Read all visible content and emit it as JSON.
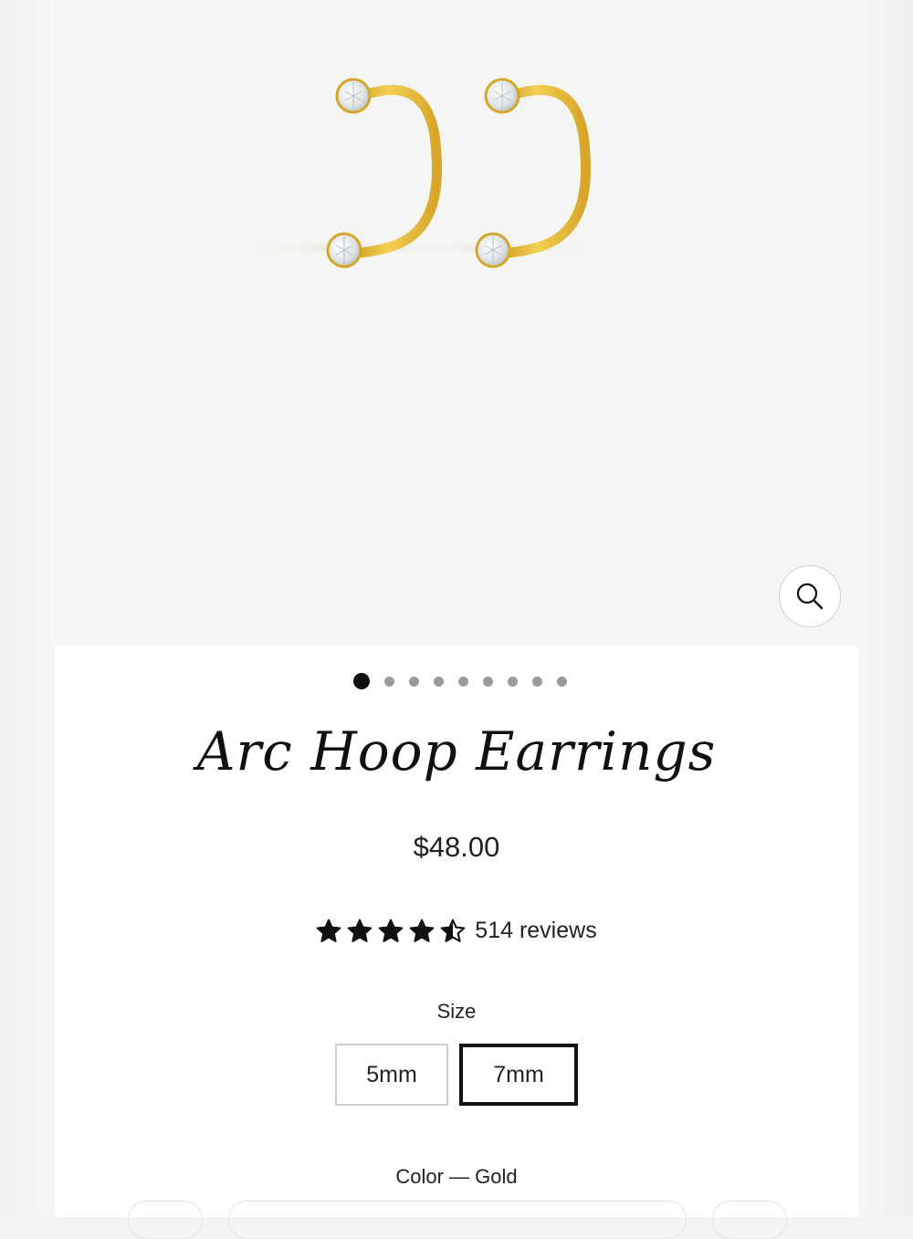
{
  "product": {
    "title": "Arc Hoop Earrings",
    "price": "$48.00",
    "rating_value": 4.5,
    "rating_max": 5,
    "review_count_label": "514 reviews"
  },
  "gallery": {
    "slide_count": 9,
    "active_index": 0,
    "zoom_icon": "search-icon"
  },
  "options": {
    "size_label": "Size",
    "sizes": [
      "5mm",
      "7mm"
    ],
    "selected_size": "7mm",
    "color_label": "Color — Gold"
  },
  "colors": {
    "gold": "#e6b422",
    "stone": "#e9ecef",
    "accent": "#111111"
  }
}
